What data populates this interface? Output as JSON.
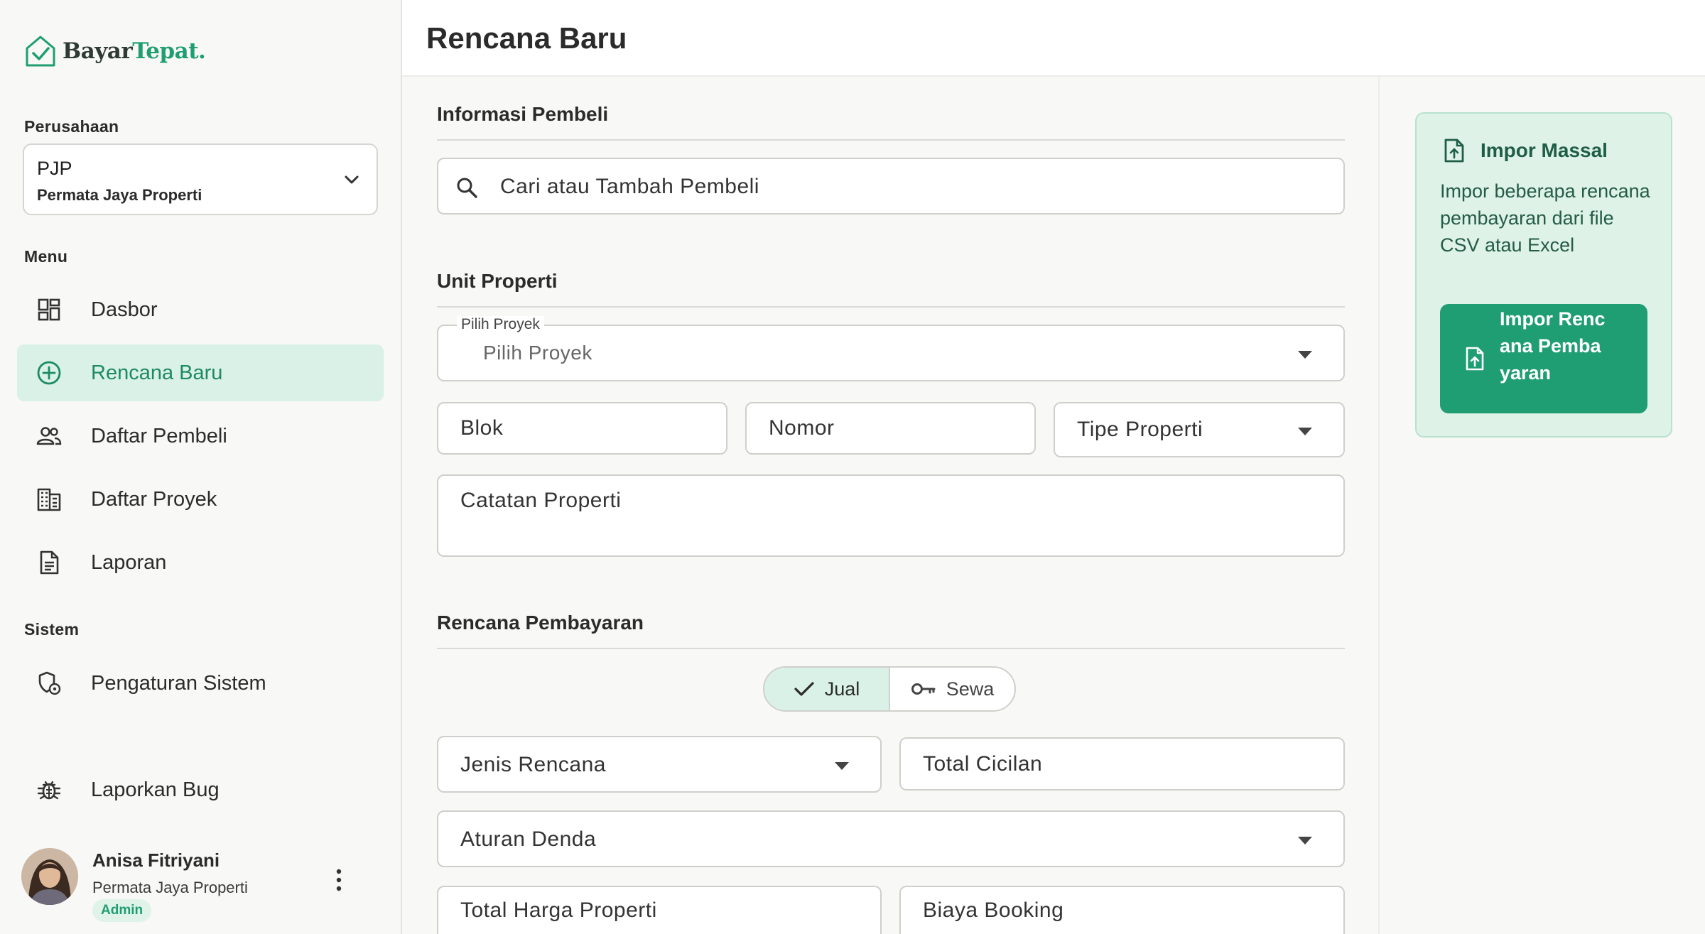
{
  "app": {
    "logo_part1": "Bayar",
    "logo_part2": "Tepat."
  },
  "sidebar": {
    "company_label": "Perusahaan",
    "company_code": "PJP",
    "company_name": "Permata Jaya Properti",
    "menu_label": "Menu",
    "items": [
      {
        "label": "Dasbor",
        "icon": "dashboard-icon"
      },
      {
        "label": "Rencana Baru",
        "icon": "plus-circle-icon",
        "active": true
      },
      {
        "label": "Daftar Pembeli",
        "icon": "users-icon"
      },
      {
        "label": "Daftar Proyek",
        "icon": "building-icon"
      },
      {
        "label": "Laporan",
        "icon": "document-icon"
      }
    ],
    "system_label": "Sistem",
    "system_items": [
      {
        "label": "Pengaturan Sistem",
        "icon": "settings-icon"
      }
    ],
    "bug_label": "Laporkan Bug",
    "user": {
      "name": "Anisa Fitriyani",
      "company": "Permata Jaya Properti",
      "role": "Admin"
    }
  },
  "header": {
    "title": "Rencana Baru"
  },
  "form": {
    "buyer_section": "Informasi Pembeli",
    "buyer_search_placeholder": "Cari atau Tambah Pembeli",
    "property_section": "Unit Properti",
    "project_legend": "Pilih Proyek",
    "project_placeholder": "Pilih Proyek",
    "block_placeholder": "Blok",
    "number_placeholder": "Nomor",
    "property_type_placeholder": "Tipe Properti",
    "property_notes_placeholder": "Catatan Properti",
    "payment_section": "Rencana Pembayaran",
    "mode_sell": "Jual",
    "mode_rent": "Sewa",
    "plan_type_placeholder": "Jenis Rencana",
    "installments_placeholder": "Total Cicilan",
    "penalty_rule_placeholder": "Aturan Denda",
    "total_price_placeholder": "Total Harga Properti",
    "booking_fee_placeholder": "Biaya Booking"
  },
  "import": {
    "title": "Impor Massal",
    "description": "Impor beberapa rencana pembayaran dari file CSV atau Excel",
    "button_label": "Impor Rencana Pembayaran"
  },
  "colors": {
    "brand": "#1f9d73",
    "active_bg": "#d9f1e6",
    "card_bg": "#def2e8"
  }
}
